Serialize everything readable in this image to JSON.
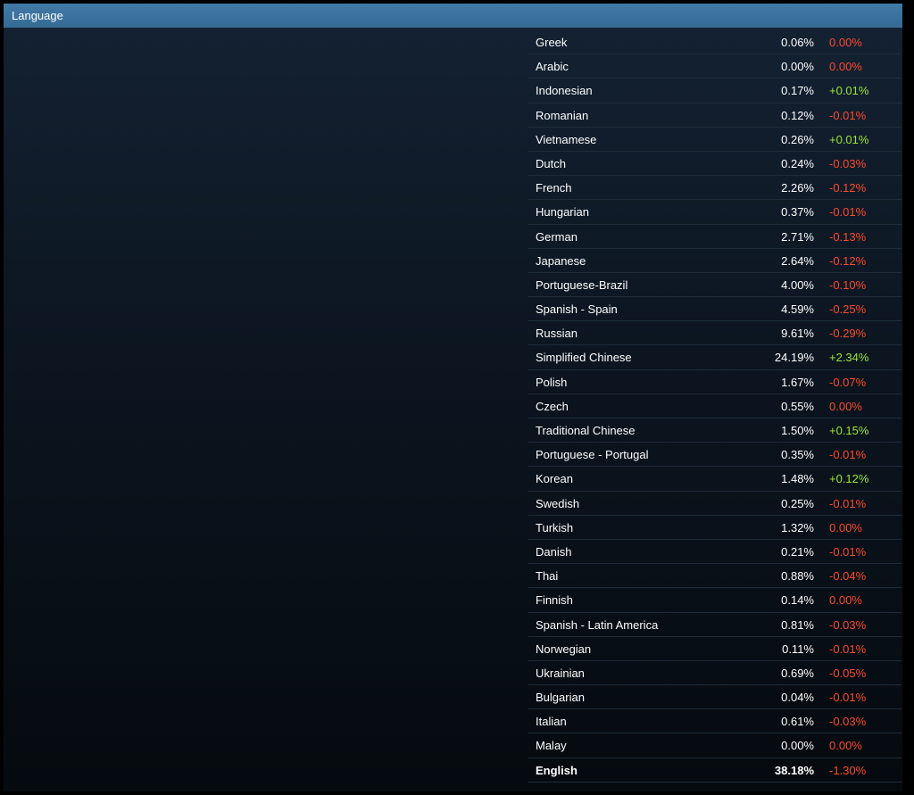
{
  "header": {
    "title": "Language"
  },
  "colors": {
    "negative": "#ff4a2a",
    "positive": "#9be43c",
    "neutral_zero": "#ff4a2a"
  },
  "languages": [
    {
      "name": "Greek",
      "percent": "0.06%",
      "change": "0.00%",
      "trend": "neutral"
    },
    {
      "name": "Arabic",
      "percent": "0.00%",
      "change": "0.00%",
      "trend": "neutral"
    },
    {
      "name": "Indonesian",
      "percent": "0.17%",
      "change": "+0.01%",
      "trend": "up"
    },
    {
      "name": "Romanian",
      "percent": "0.12%",
      "change": "-0.01%",
      "trend": "down"
    },
    {
      "name": "Vietnamese",
      "percent": "0.26%",
      "change": "+0.01%",
      "trend": "up"
    },
    {
      "name": "Dutch",
      "percent": "0.24%",
      "change": "-0.03%",
      "trend": "down"
    },
    {
      "name": "French",
      "percent": "2.26%",
      "change": "-0.12%",
      "trend": "down"
    },
    {
      "name": "Hungarian",
      "percent": "0.37%",
      "change": "-0.01%",
      "trend": "down"
    },
    {
      "name": "German",
      "percent": "2.71%",
      "change": "-0.13%",
      "trend": "down"
    },
    {
      "name": "Japanese",
      "percent": "2.64%",
      "change": "-0.12%",
      "trend": "down"
    },
    {
      "name": "Portuguese-Brazil",
      "percent": "4.00%",
      "change": "-0.10%",
      "trend": "down"
    },
    {
      "name": "Spanish - Spain",
      "percent": "4.59%",
      "change": "-0.25%",
      "trend": "down"
    },
    {
      "name": "Russian",
      "percent": "9.61%",
      "change": "-0.29%",
      "trend": "down"
    },
    {
      "name": "Simplified Chinese",
      "percent": "24.19%",
      "change": "+2.34%",
      "trend": "up"
    },
    {
      "name": "Polish",
      "percent": "1.67%",
      "change": "-0.07%",
      "trend": "down"
    },
    {
      "name": "Czech",
      "percent": "0.55%",
      "change": "0.00%",
      "trend": "neutral"
    },
    {
      "name": "Traditional Chinese",
      "percent": "1.50%",
      "change": "+0.15%",
      "trend": "up"
    },
    {
      "name": "Portuguese - Portugal",
      "percent": "0.35%",
      "change": "-0.01%",
      "trend": "down"
    },
    {
      "name": "Korean",
      "percent": "1.48%",
      "change": "+0.12%",
      "trend": "up"
    },
    {
      "name": "Swedish",
      "percent": "0.25%",
      "change": "-0.01%",
      "trend": "down"
    },
    {
      "name": "Turkish",
      "percent": "1.32%",
      "change": "0.00%",
      "trend": "neutral"
    },
    {
      "name": "Danish",
      "percent": "0.21%",
      "change": "-0.01%",
      "trend": "down"
    },
    {
      "name": "Thai",
      "percent": "0.88%",
      "change": "-0.04%",
      "trend": "down"
    },
    {
      "name": "Finnish",
      "percent": "0.14%",
      "change": "0.00%",
      "trend": "neutral"
    },
    {
      "name": "Spanish - Latin America",
      "percent": "0.81%",
      "change": "-0.03%",
      "trend": "down"
    },
    {
      "name": "Norwegian",
      "percent": "0.11%",
      "change": "-0.01%",
      "trend": "down"
    },
    {
      "name": "Ukrainian",
      "percent": "0.69%",
      "change": "-0.05%",
      "trend": "down"
    },
    {
      "name": "Bulgarian",
      "percent": "0.04%",
      "change": "-0.01%",
      "trend": "down"
    },
    {
      "name": "Italian",
      "percent": "0.61%",
      "change": "-0.03%",
      "trend": "down"
    },
    {
      "name": "Malay",
      "percent": "0.00%",
      "change": "0.00%",
      "trend": "neutral"
    },
    {
      "name": "English",
      "percent": "38.18%",
      "change": "-1.30%",
      "trend": "down",
      "emphasis": true
    }
  ]
}
